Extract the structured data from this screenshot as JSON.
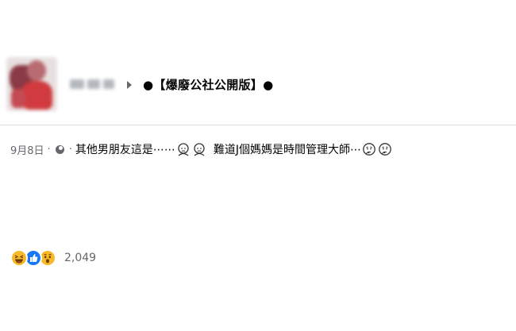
{
  "post": {
    "group_name": "●【爆廢公社公開版】●",
    "date": "9月8日",
    "separator": "·",
    "text_part1": "其他男朋友這是⋯⋯",
    "text_part2": "難道J個媽媽是時間管理大師⋯",
    "icons": [
      "avatar",
      "caret-right-icon",
      "globe-icon",
      "pensive-face-icon",
      "pensive-face-icon",
      "thinking-face-icon",
      "thinking-face-icon"
    ]
  },
  "reactions": {
    "types": [
      "haha",
      "like",
      "wow"
    ],
    "count": "2,049"
  },
  "colors": {
    "text": "#050505",
    "secondary": "#65676b",
    "like_blue": "#1877f2",
    "emoji_yellow": "#f7b928",
    "divider": "#dadde1"
  }
}
